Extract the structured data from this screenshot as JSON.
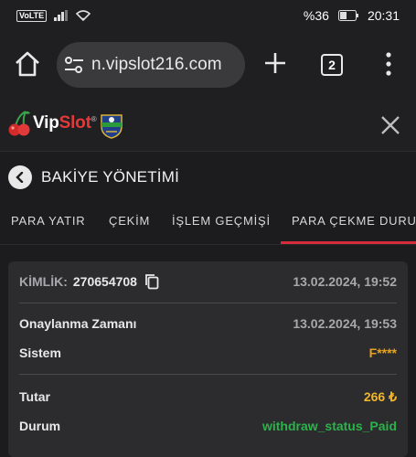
{
  "status_bar": {
    "volte": "VoLTE",
    "battery": "%36",
    "time": "20:31"
  },
  "browser": {
    "url": "n.vipslot216.com",
    "tab_count": "2"
  },
  "site": {
    "brand_vip": "Vip",
    "brand_slot": "Slot",
    "brand_mark": "®"
  },
  "page": {
    "title": "BAKİYE YÖNETİMİ"
  },
  "tabs": [
    {
      "label": "PARA YATIR"
    },
    {
      "label": "ÇEKİM"
    },
    {
      "label": "İŞLEM GEÇMİŞİ"
    },
    {
      "label": "PARA ÇEKME DURUMU",
      "active": true
    }
  ],
  "transaction": {
    "id_label": "KİMLİK:",
    "id_value": "270654708",
    "created_at": "13.02.2024, 19:52",
    "approved_label": "Onaylanma Zamanı",
    "approved_at": "13.02.2024, 19:53",
    "system_label": "Sistem",
    "system_value": "F****",
    "amount_label": "Tutar",
    "amount_value": "266 ₺",
    "status_label": "Durum",
    "status_value": "withdraw_status_Paid"
  },
  "colors": {
    "accent": "#d62b3a",
    "gold": "#e6a320",
    "green": "#2bb34a"
  }
}
